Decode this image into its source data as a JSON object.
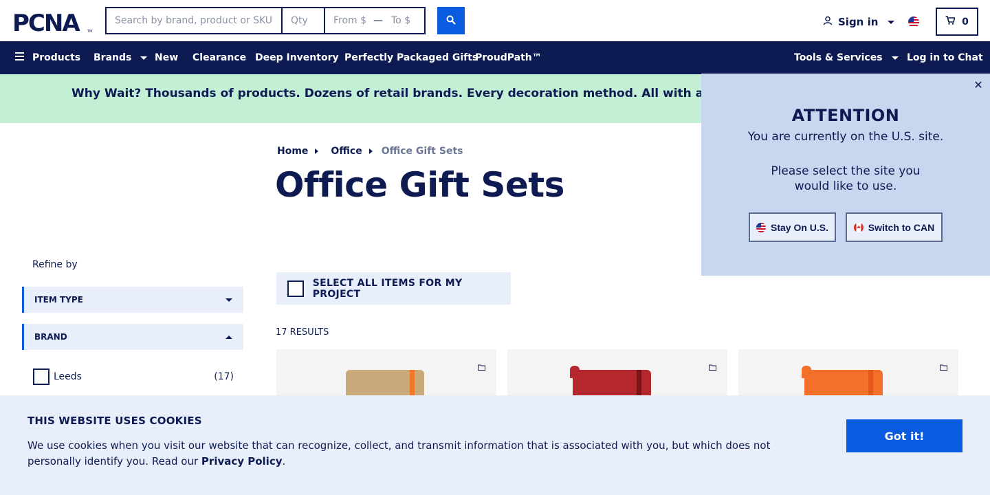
{
  "brand": {
    "logo_text": "PCNA",
    "trademark": "TM"
  },
  "search": {
    "placeholder": "Search by brand, product or SKU",
    "qty_placeholder": "Qty",
    "from_placeholder": "From $",
    "range_separator": "—",
    "to_placeholder": "To $",
    "button_icon": "search-icon"
  },
  "account": {
    "signin_label": "Sign in",
    "user_icon": "user-icon"
  },
  "region": {
    "flag_icon": "us-flag-icon"
  },
  "cart": {
    "count": "0",
    "icon": "cart-icon"
  },
  "nav": {
    "products": "Products",
    "brands": "Brands",
    "new": "New",
    "clearance": "Clearance",
    "deep_inventory": "Deep Inventory",
    "perfectly_packaged": "Perfectly Packaged Gifts",
    "proudpath": "ProudPath™",
    "tools_services": "Tools & Services",
    "chat": "Log in to Chat"
  },
  "promo": {
    "text": "Why Wait? Thousands of products. Dozens of retail brands. Every decoration method. All with a standard"
  },
  "breadcrumb": {
    "home": "Home",
    "office": "Office",
    "current": "Office Gift Sets"
  },
  "page": {
    "title": "Office Gift Sets"
  },
  "filters": {
    "refine_label": "Refine by",
    "item_type": "ITEM TYPE",
    "brand": "BRAND",
    "options": [
      {
        "label": "Leeds",
        "count": "(17)"
      }
    ]
  },
  "project": {
    "select_all_label": "SELECT ALL ITEMS FOR MY PROJECT"
  },
  "results": {
    "count_label": "17 RESULTS"
  },
  "products": [
    {
      "color": "#c9a87a",
      "band": "#f07a2a"
    },
    {
      "color": "#b3272d",
      "band": "#7e1418"
    },
    {
      "color": "#f36f2a",
      "band": "#e4571a"
    }
  ],
  "site_modal": {
    "title": "ATTENTION",
    "line1": "You are currently on the U.S. site.",
    "line2": "Please select the site you",
    "line3": "would like to use.",
    "stay_label": "Stay On U.S.",
    "switch_label": "Switch to CAN",
    "close_icon": "close-icon"
  },
  "cookie": {
    "title": "THIS WEBSITE USES COOKIES",
    "text_line1": "We use cookies when you visit our website that can recognize, collect, and transmit information that is associated with you, but which does not",
    "text_line2_prefix": "personally identify you. Read our",
    "policy_link": "Privacy Policy",
    "text_line2_suffix": ".",
    "accept_label": "Got it!"
  },
  "colors": {
    "navy": "#0d1b52",
    "accent_blue": "#0a5be0",
    "promo_bg": "#c3efd5",
    "modal_bg": "#c8d7f0",
    "light_panel": "#e9effa"
  }
}
